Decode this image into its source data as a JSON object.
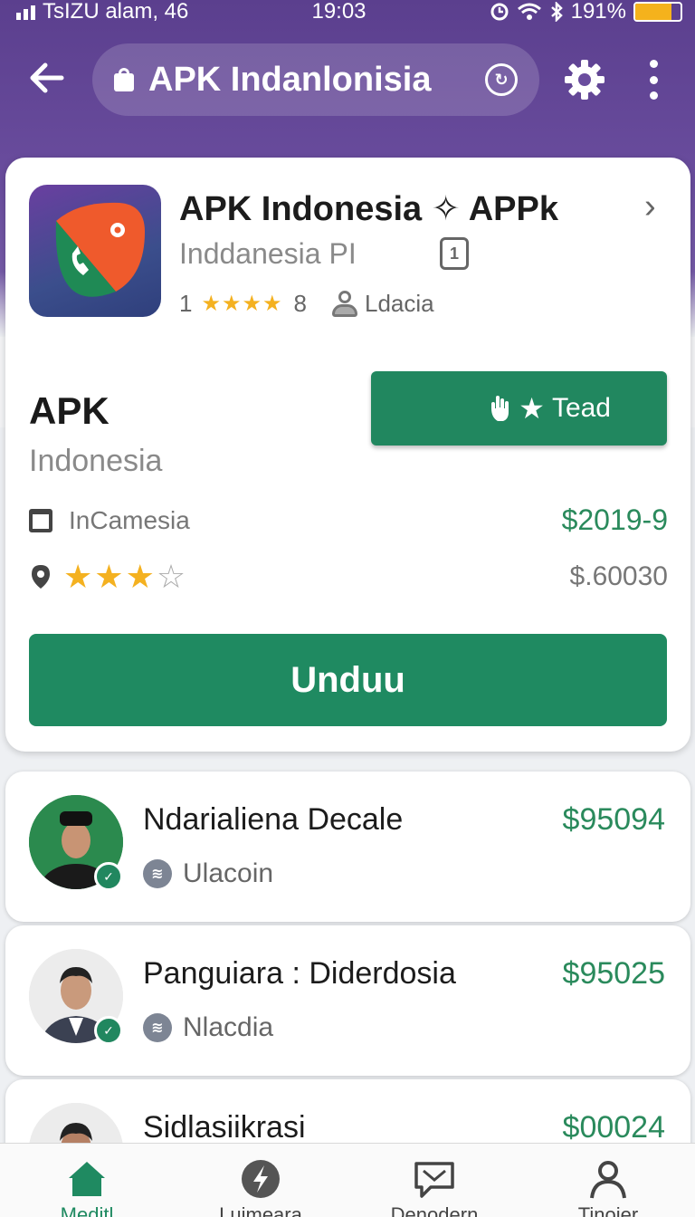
{
  "status_bar": {
    "carrier": "TsIZU alam, 46",
    "time": "19:03",
    "battery": "191%"
  },
  "header": {
    "url_text": "APK Indanlonisia"
  },
  "app_card": {
    "title": "APK Indonesia ✧ APPk",
    "subtitle": "Inddanesia PI",
    "rating_number": "1",
    "rating_stars": "★★★★",
    "rating_count": "8",
    "publisher": "Ldacia",
    "big_title": "APK",
    "big_subtitle": "Indonesia",
    "read_button_label": "Tead",
    "category": "InCamesia",
    "price_primary": "$2019-9",
    "rating_level": 3,
    "rating_max": 4,
    "price_secondary": "$.60030",
    "download_label": "Unduu"
  },
  "list": [
    {
      "name": "Ndarialiena Decale",
      "price": "$95094",
      "sub": "Ulacoin"
    },
    {
      "name": "Panguiara : Diderdosia",
      "price": "$95025",
      "sub": "Nlacdia"
    },
    {
      "name": "Sidlasiikrasi",
      "price": "$00024",
      "sub": ""
    }
  ],
  "bottom_nav": [
    {
      "label": "Meditl",
      "icon": "home-icon",
      "active": true
    },
    {
      "label": "Luimeara",
      "icon": "bolt-icon",
      "active": false
    },
    {
      "label": "Denodern",
      "icon": "chat-icon",
      "active": false
    },
    {
      "label": "Tinoier",
      "icon": "profile-icon",
      "active": false
    }
  ],
  "colors": {
    "header_purple": "#5b3f8e",
    "accent_green": "#21875f",
    "star_gold": "#f4b120"
  }
}
